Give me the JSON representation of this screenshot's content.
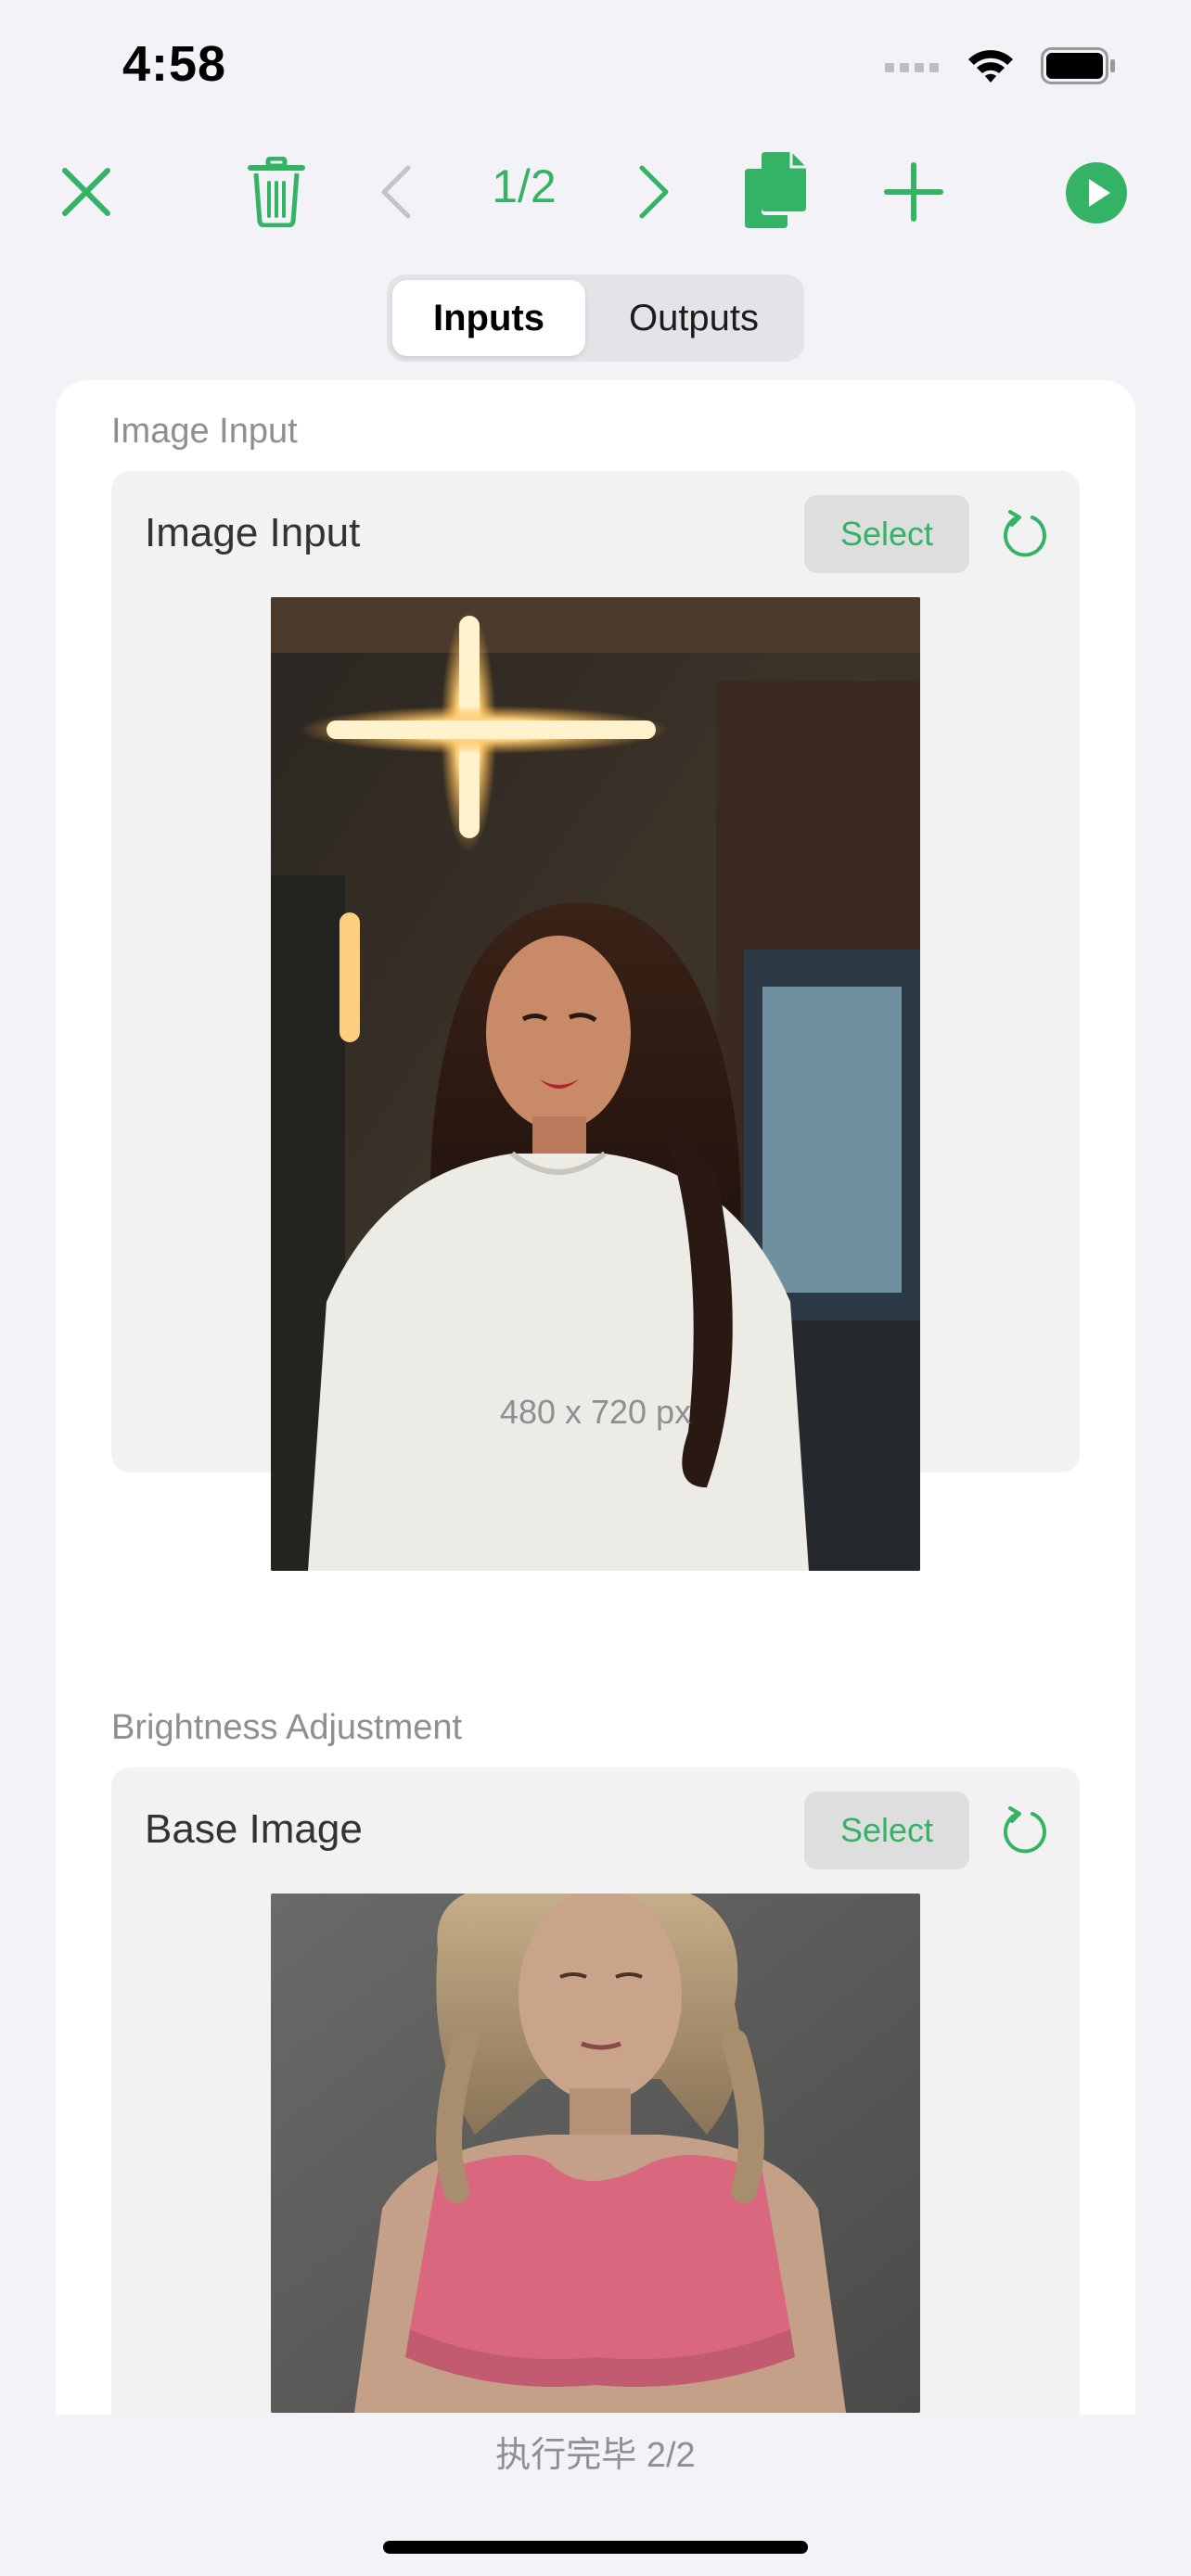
{
  "status_bar": {
    "time": "4:58",
    "icons": [
      "signal-icon",
      "wifi-icon",
      "battery-icon"
    ]
  },
  "toolbar": {
    "page_indicator": "1/2",
    "icons": [
      "close-icon",
      "trash-icon",
      "chevron-left-icon",
      "chevron-right-icon",
      "copy-icon",
      "plus-icon",
      "play-icon"
    ],
    "accent_color": "#34b366"
  },
  "tabs": {
    "inputs_label": "Inputs",
    "outputs_label": "Outputs",
    "selected": "Inputs"
  },
  "sections": {
    "image_input": {
      "title": "Image Input",
      "panel_label": "Image Input",
      "select_label": "Select",
      "dimensions": "480 x 720 px"
    },
    "brightness": {
      "title": "Brightness Adjustment",
      "panel_label": "Base Image",
      "select_label": "Select"
    }
  },
  "footer": {
    "status": "执行完毕 2/2"
  }
}
